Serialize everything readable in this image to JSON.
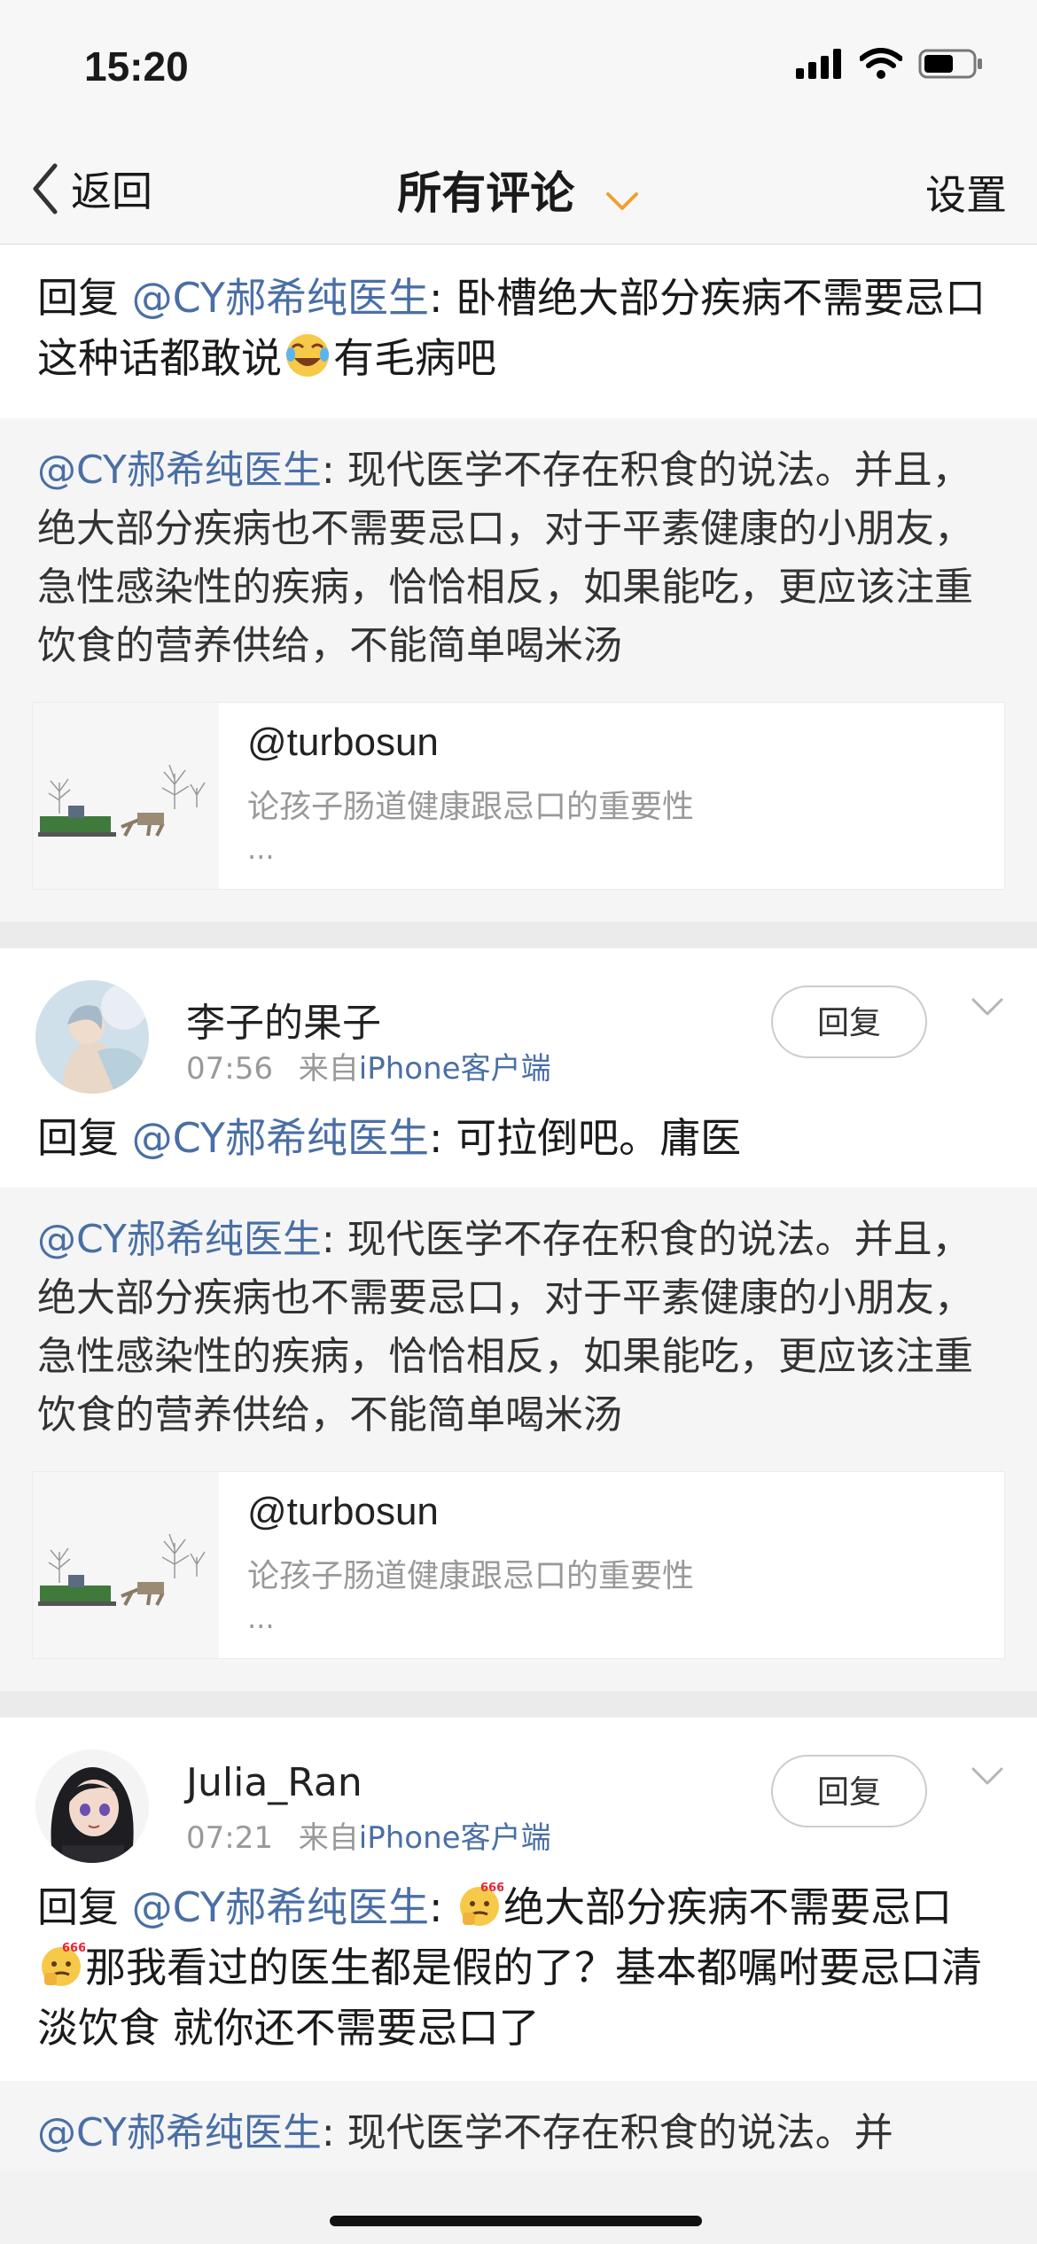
{
  "status_bar": {
    "time": "15:20"
  },
  "nav": {
    "back_label": "返回",
    "title": "所有评论",
    "settings_label": "设置"
  },
  "top_comment": {
    "reply_prefix": "回复 ",
    "mention": "@CY郝希纯医生",
    "text_before_emoji": ": 卧槽绝大部分疾病不需要忌口这种话都敢说",
    "text_after_emoji": "有毛病吧"
  },
  "quote": {
    "mention": "@CY郝希纯医生",
    "text": ": 现代医学不存在积食的说法。并且，绝大部分疾病也不需要忌口，对于平素健康的小朋友，急性感染性的疾病，恰恰相反，如果能吃，更应该注重饮食的营养供给，不能简单喝米汤"
  },
  "card": {
    "author": "@turbosun",
    "desc": "论孩子肠道健康跟忌口的重要性",
    "more": "..."
  },
  "comments": [
    {
      "username": "李子的果子",
      "time": "07:56",
      "source_prefix": "来自",
      "source": "iPhone客户端",
      "reply_label": "回复",
      "reply_prefix": "回复 ",
      "mention": "@CY郝希纯医生",
      "text": ": 可拉倒吧。庸医"
    },
    {
      "username": "Julia_Ran",
      "time": "07:21",
      "source_prefix": "来自",
      "source": "iPhone客户端",
      "reply_label": "回复",
      "reply_prefix": "回复 ",
      "mention": "@CY郝希纯医生",
      "text_part1": ": ",
      "text_part2": "绝大部分疾病不需要忌口",
      "text_part3": "那我看过的医生都是假的了？基本都嘱咐要忌口清淡饮食 就你还不需要忌口了",
      "emoji_badge": "666"
    }
  ],
  "bottom_quote": {
    "mention": "@CY郝希纯医生",
    "text": ": 现代医学不存在积食的说法。并"
  },
  "colors": {
    "link": "#4a6fa5",
    "accent_chevron": "#f0a030"
  }
}
